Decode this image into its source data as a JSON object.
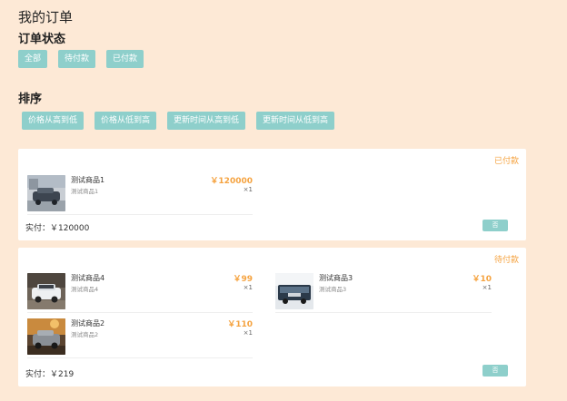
{
  "page": {
    "title": "我的订单"
  },
  "status_section": {
    "title": "订单状态",
    "buttons": [
      "全部",
      "待付款",
      "已付款"
    ]
  },
  "sort_section": {
    "title": "排序",
    "buttons": [
      "价格从高到低",
      "价格从低到高",
      "更新时间从高到低",
      "更新时间从低到高"
    ]
  },
  "orders": [
    {
      "status": "已付款",
      "items": [
        {
          "name": "测试商品1",
          "sub": "测试商品1",
          "price": "￥120000",
          "qty": "×1"
        }
      ],
      "total": "实付：￥120000",
      "action": "否"
    },
    {
      "status": "待付款",
      "items": [
        {
          "name": "测试商品4",
          "sub": "测试商品4",
          "price": "￥99",
          "qty": "×1"
        },
        {
          "name": "测试商品3",
          "sub": "测试商品3",
          "price": "￥10",
          "qty": "×1"
        },
        {
          "name": "测试商品2",
          "sub": "测试商品2",
          "price": "￥110",
          "qty": "×1"
        }
      ],
      "total": "实付：￥219",
      "action": "否"
    }
  ],
  "colors": {
    "accent": "#8ecfcb",
    "price": "#f5a340",
    "background": "#fde9d6"
  }
}
